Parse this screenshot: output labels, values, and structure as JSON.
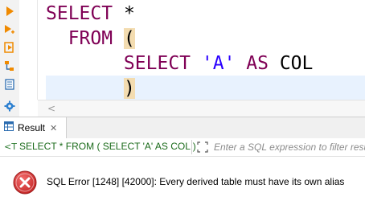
{
  "editor": {
    "lines": [
      {
        "parts": [
          {
            "t": "SELECT",
            "c": "kw"
          },
          {
            "t": " *",
            "c": "op"
          }
        ]
      },
      {
        "parts": [
          {
            "t": "  FROM",
            "c": "kw"
          },
          {
            "t": " ",
            "c": "op"
          },
          {
            "t": "(",
            "c": "paren"
          }
        ]
      },
      {
        "parts": [
          {
            "t": "       SELECT",
            "c": "kw"
          },
          {
            "t": " ",
            "c": "op"
          },
          {
            "t": "'A'",
            "c": "str"
          },
          {
            "t": " ",
            "c": "op"
          },
          {
            "t": "AS",
            "c": "kw"
          },
          {
            "t": " COL",
            "c": "op"
          }
        ]
      },
      {
        "parts": [
          {
            "t": "       ",
            "c": "op"
          },
          {
            "t": ")",
            "c": "paren"
          }
        ]
      }
    ]
  },
  "toolbar": {
    "icons": [
      "run-statement-icon",
      "run-script-icon",
      "execute-new-tab-icon",
      "explain-plan-icon",
      "load-script-icon",
      "settings-icon"
    ]
  },
  "result_tab": {
    "label": "Result",
    "close": "✕"
  },
  "filter": {
    "query_text": "SELECT * FROM ( SELECT 'A' AS COL )",
    "placeholder": "Enter a SQL expression to filter results"
  },
  "error": {
    "message": "SQL Error [1248] [42000]: Every derived table must have its own alias"
  },
  "colors": {
    "keyword": "#7f0055",
    "string": "#2a00ff",
    "bracket_highlight": "#f3dcb0",
    "current_line": "#e8f2fe",
    "error_red": "#d32f2f"
  }
}
